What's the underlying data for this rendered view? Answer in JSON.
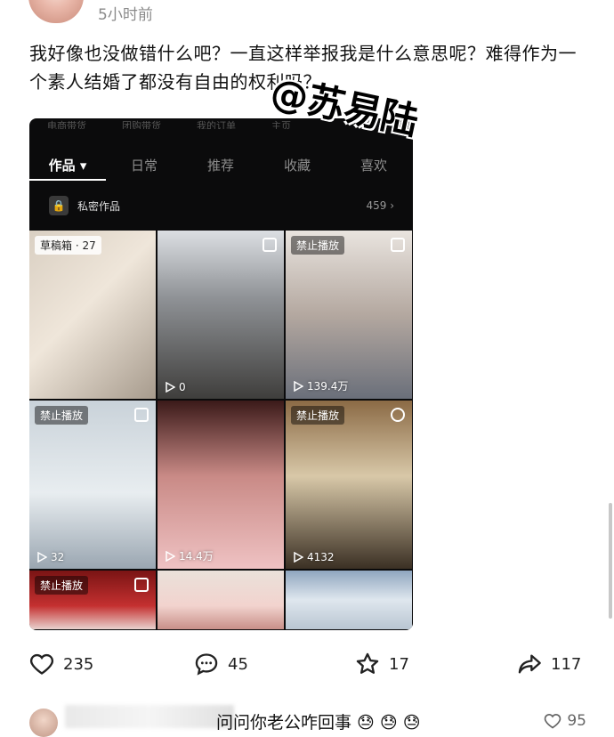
{
  "post": {
    "time": "5小时前",
    "text": "我好像也没做错什么吧？一直这样举报我是什么意思呢？难得作为一个素人结婚了都没有自由的权利吗？",
    "watermark": "@苏易陆"
  },
  "phone": {
    "faded_tabs": [
      "电商带货",
      "团购带货",
      "我的订单",
      "主页"
    ],
    "tabs": [
      "作品 ▾",
      "日常",
      "推荐",
      "收藏",
      "喜欢"
    ],
    "private_label": "私密作品",
    "private_count": "459 ›",
    "grid": [
      {
        "badge": "草稿箱 · 27",
        "plays": ""
      },
      {
        "badge": "",
        "plays": "0"
      },
      {
        "badge": "禁止播放",
        "plays": "139.4万"
      },
      {
        "badge": "禁止播放",
        "plays": "32"
      },
      {
        "badge": "",
        "plays": "14.4万"
      },
      {
        "badge": "禁止播放",
        "plays": "4132"
      },
      {
        "badge": "禁止播放",
        "plays": ""
      },
      {
        "badge": "",
        "plays": ""
      },
      {
        "badge": "",
        "plays": ""
      }
    ]
  },
  "actions": {
    "likes": "235",
    "comments": "45",
    "favorites": "17",
    "shares": "117"
  },
  "comment": {
    "text": "问问你老公咋回事 😓 😓 😓",
    "likes": "95"
  }
}
